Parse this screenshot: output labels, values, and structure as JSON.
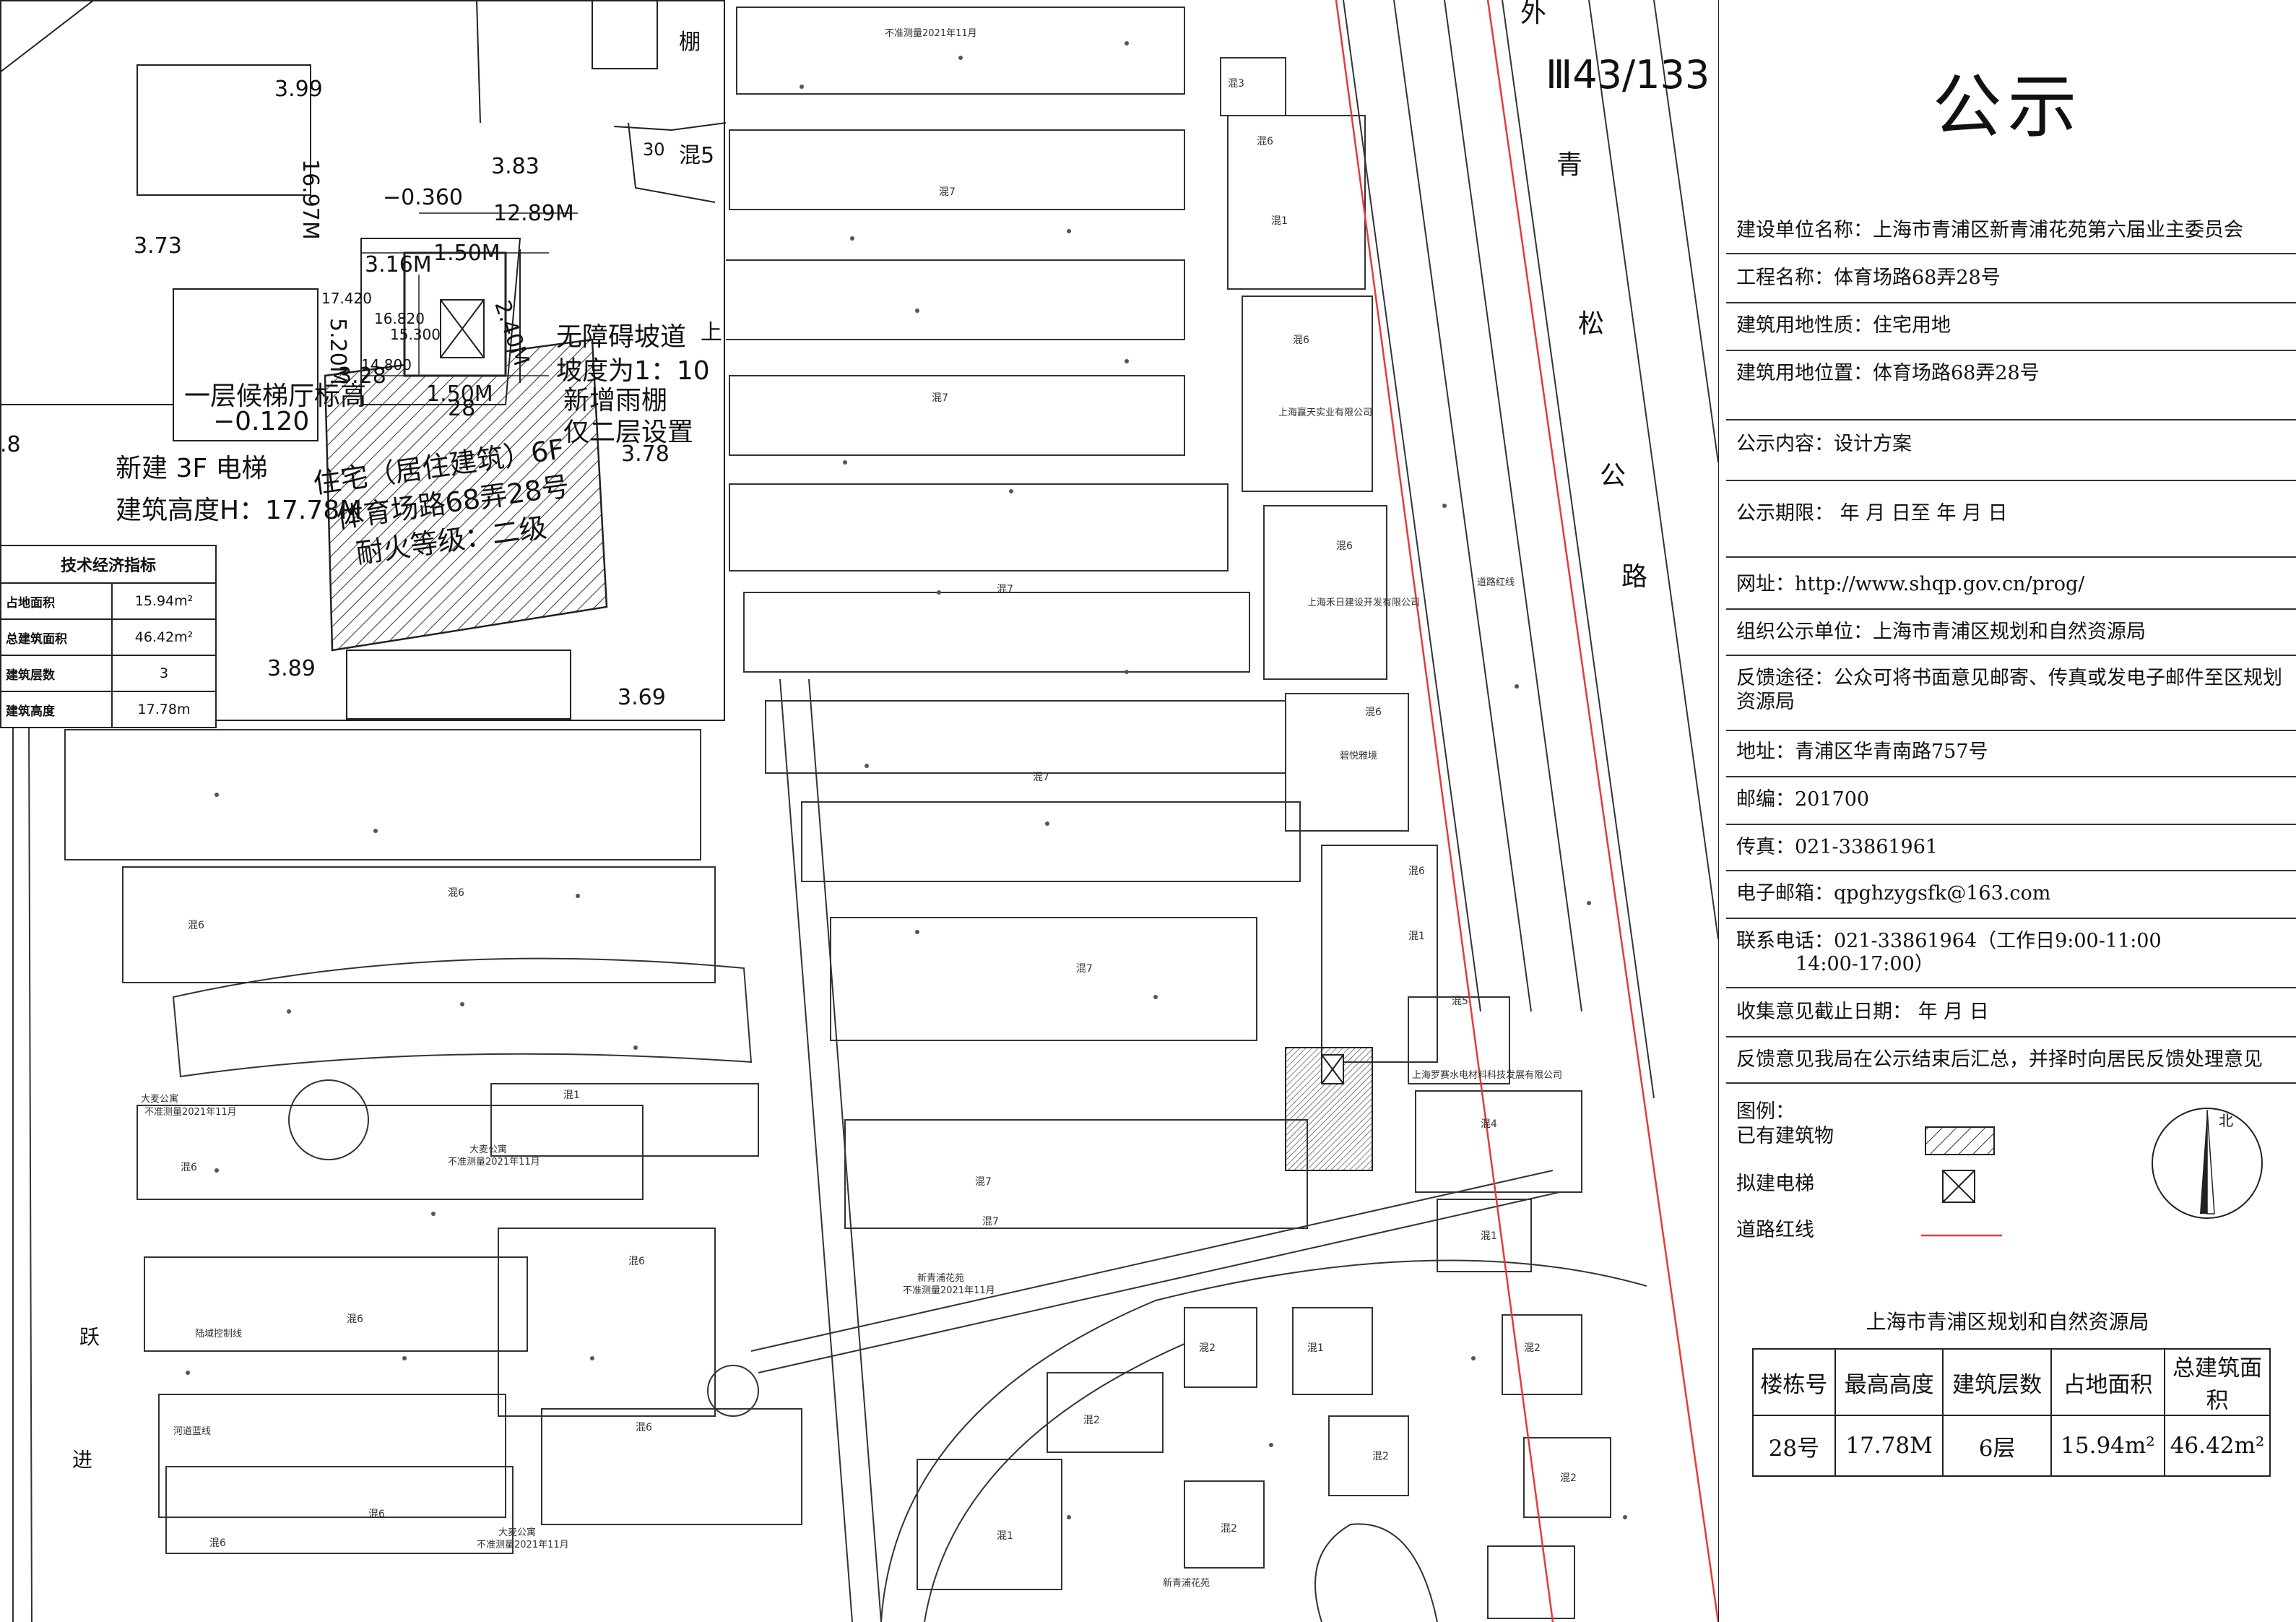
{
  "map": {
    "sheet_code": "Ⅲ43/133",
    "road_name_chars": [
      "外",
      "青",
      "松",
      "公",
      "路"
    ],
    "road_right_bottom_chars": [
      "跃",
      "进"
    ],
    "inset_labels": {
      "dim_top": "12.89M",
      "level_neg": "−0.360",
      "dim_316": "3.16M",
      "dim_150a": "1.50M",
      "dim_150b": "1.50M",
      "dim_240": "2.40M",
      "dim_520": "5.20M",
      "dim_1697": "16.97M",
      "dim_328": "3.28",
      "dim_28": "28",
      "lvl_17420": "17.420",
      "lvl_16820": "16.820",
      "lvl_15300": "15.300",
      "lvl_14800": "14.800",
      "elev_399": "3.99",
      "elev_373": "3.73",
      "elev_383": "3.83",
      "elev_389": "3.89",
      "elev_369": "3.69",
      "elev_378": "3.78",
      "elev_8": ".8",
      "lift_hall": "一层候梯厅标高",
      "lift_hall_lvl": "−0.120",
      "new_lift": "新建 3F 电梯",
      "new_lift_height": "建筑高度H：17.78M",
      "ramp1": "无障碍坡道",
      "ramp2": "坡度为1：10",
      "ramp3": "新增雨棚",
      "ramp4": "仅二层设置",
      "bldg1": "住宅（居住建筑）6F",
      "bldg2": "体育场路68弄28号",
      "bldg3": "耐火等级：二级",
      "shed": "棚",
      "mix5": "混5",
      "n30": "30",
      "up": "上"
    },
    "tech_table": {
      "title": "技术经济指标",
      "rows": [
        {
          "k": "占地面积",
          "v": "15.94m²"
        },
        {
          "k": "总建筑面积",
          "v": "46.42m²"
        },
        {
          "k": "建筑层数",
          "v": "3"
        },
        {
          "k": "建筑高度",
          "v": "17.78m"
        }
      ]
    },
    "companies": [
      "上海赢天实业有限公司",
      "上海禾日建设开发有限公司",
      "上海罗赛水电材料科技发展有限公司"
    ],
    "survey_notes": [
      "不准测量2021年11月",
      "大麦公寓",
      "新青浦花苑",
      "碧悦雅境"
    ],
    "road_redline_label": "道路红线",
    "land_redline": "陆域控制线",
    "river_line": "河道蓝线"
  },
  "panel": {
    "title": "公示",
    "rows": [
      "建设单位名称：上海市青浦区新青浦花苑第六届业主委员会",
      "工程名称：体育场路68弄28号",
      "建筑用地性质：住宅用地",
      "建筑用地位置：体育场路68弄28号",
      "公示内容：设计方案",
      "公示期限：    年    月    日至    年    月    日",
      "网址：http://www.shqp.gov.cn/prog/",
      "组织公示单位：上海市青浦区规划和自然资源局",
      "反馈途径：公众可将书面意见邮寄、传真或发电子邮件至区规划资源局",
      "地址：青浦区华青南路757号",
      "邮编：201700",
      "传真：021-33861961",
      "电子邮箱：qpghzygsfk@163.com",
      "联系电话：021-33861964（工作日9:00-11:00",
      "14:00-17:00）",
      "收集意见截止日期：    年    月    日",
      "反馈意见我局在公示结束后汇总，并择时向居民反馈处理意见"
    ],
    "legend": {
      "title": "图例：",
      "existing": "已有建筑物",
      "new_lift": "拟建电梯",
      "redline": "道路红线",
      "north": "北"
    },
    "org": "上海市青浦区规划和自然资源局",
    "summary": {
      "headers": [
        "楼栋号",
        "最高高度",
        "建筑层数",
        "占地面积",
        "总建筑面积"
      ],
      "values": [
        "28号",
        "17.78M",
        "6层",
        "15.94m²",
        "46.42m²"
      ]
    }
  },
  "colors": {
    "redline": "#e53a3a",
    "line": "#222222",
    "hatch": "#333333"
  }
}
